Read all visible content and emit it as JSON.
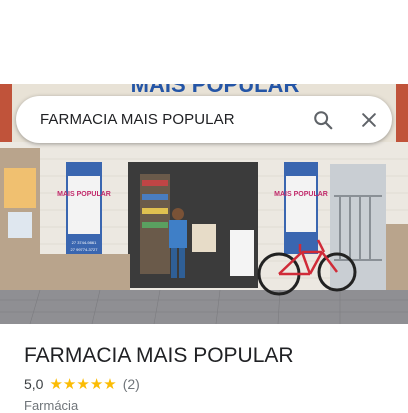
{
  "search": {
    "query": "FARMACIA MAIS POPULAR",
    "search_icon": "search-icon",
    "close_icon": "close-icon"
  },
  "photo": {
    "sign_text": "MAIS POPULAR",
    "poster_text": "MAIS POPULAR",
    "poster_lines": [
      "27 3744-9861",
      "27 99774-3727"
    ]
  },
  "place": {
    "name": "FARMACIA MAIS POPULAR",
    "rating": "5,0",
    "stars": 5,
    "review_count": "(2)",
    "category": "Farmácia"
  },
  "colors": {
    "star": "#fbbc04",
    "text_primary": "#202124",
    "text_secondary": "#70757a"
  }
}
